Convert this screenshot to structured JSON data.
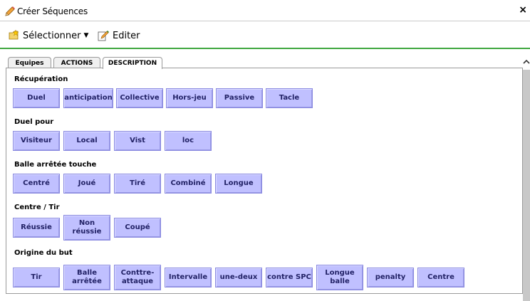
{
  "window": {
    "title": "Créer Séquences",
    "close_label": "×"
  },
  "toolbar": {
    "select_label": "Sélectionner",
    "select_caret": "▼",
    "edit_label": "Editer"
  },
  "tabs": [
    "Equipes",
    "ACTIONS",
    "DESCRIPTION"
  ],
  "active_tab": "DESCRIPTION",
  "colors": {
    "chip_fill": "#c0c0ff",
    "chip_border": "#8a8ae0",
    "toolbar_rule": "#3fa73f"
  },
  "sections": [
    {
      "label": "Récupération",
      "buttons": [
        "Duel",
        "anticipation",
        "Collective",
        "Hors-jeu",
        "Passive",
        "Tacle"
      ]
    },
    {
      "label": "Duel pour",
      "buttons": [
        "Visiteur",
        "Local",
        "Vist",
        "loc"
      ]
    },
    {
      "label": "Balle arrêtée touche",
      "buttons": [
        "Centré",
        "Joué",
        "Tiré",
        "Combiné",
        "Longue"
      ]
    },
    {
      "label": "Centre / Tir",
      "buttons": [
        [
          "Réussie"
        ],
        [
          "Non",
          "réussie"
        ],
        [
          "Coupé"
        ]
      ]
    },
    {
      "label": "Origine du but",
      "buttons": [
        [
          "Tir"
        ],
        [
          "Balle",
          "arrêtée"
        ],
        [
          "Conttre-",
          "attaque"
        ],
        [
          "Intervalle"
        ],
        [
          "une-deux"
        ],
        [
          "contre SPC"
        ],
        [
          "Longue",
          "balle"
        ],
        [
          "penalty"
        ],
        [
          "Centre"
        ]
      ]
    }
  ]
}
